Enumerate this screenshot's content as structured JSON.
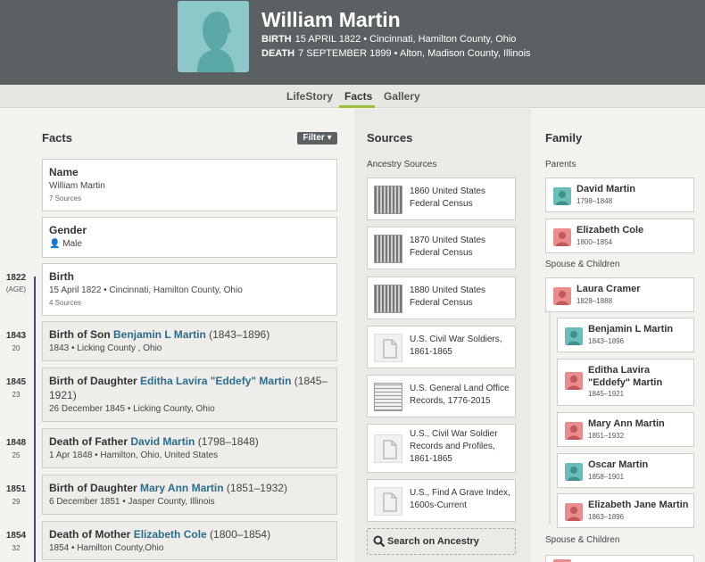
{
  "header": {
    "name": "William Martin",
    "birth_label": "BIRTH",
    "birth_value": "15 APRIL 1822 • Cincinnati, Hamilton County, Ohio",
    "death_label": "DEATH",
    "death_value": "7 SEPTEMBER 1899 • Alton, Madison County, Illinois"
  },
  "tabs": {
    "lifestory": "LifeStory",
    "facts": "Facts",
    "gallery": "Gallery",
    "active": "Facts"
  },
  "facts_col": {
    "title": "Facts",
    "filter": "Filter",
    "items": [
      {
        "title": "Name",
        "detail": "William Martin",
        "sources": "7 Sources"
      },
      {
        "title": "Gender",
        "detail": "Male"
      },
      {
        "year": "1822",
        "age": "(AGE)",
        "title": "Birth",
        "detail": "15 April 1822 • Cincinnati, Hamilton County, Ohio",
        "sources": "4 Sources"
      },
      {
        "year": "1843",
        "age": "20",
        "prefix": "Birth of Son",
        "link": "Benjamin L Martin",
        "range": "(1843–1896)",
        "detail": "1843 • Licking County , Ohio"
      },
      {
        "year": "1845",
        "age": "23",
        "prefix": "Birth of Daughter",
        "link": "Editha Lavira \"Eddefy\" Martin",
        "range": "(1845–1921)",
        "detail": "26 December 1845 • Licking County, Ohio"
      },
      {
        "year": "1848",
        "age": "25",
        "prefix": "Death of Father",
        "link": "David Martin",
        "range": "(1798–1848)",
        "detail": "1 Apr 1848 • Hamilton, Ohio, United States"
      },
      {
        "year": "1851",
        "age": "29",
        "prefix": "Birth of Daughter",
        "link": "Mary Ann Martin",
        "range": "(1851–1932)",
        "detail": "6 December 1851 • Jasper County, Illinois"
      },
      {
        "year": "1854",
        "age": "32",
        "prefix": "Death of Mother",
        "link": "Elizabeth Cole",
        "range": "(1800–1854)",
        "detail": "1854 • Hamilton County,Ohio"
      }
    ]
  },
  "sources_col": {
    "title": "Sources",
    "subtitle": "Ancestry Sources",
    "items": [
      {
        "label": "1860 United States Federal Census",
        "thumb": "census"
      },
      {
        "label": "1870 United States Federal Census",
        "thumb": "census"
      },
      {
        "label": "1880 United States Federal Census",
        "thumb": "census"
      },
      {
        "label": "U.S. Civil War Soldiers, 1861-1865",
        "thumb": "doc"
      },
      {
        "label": "U.S. General Land Office Records, 1776-2015",
        "thumb": "census"
      },
      {
        "label": "U.S., Civil War Soldier Records and Profiles, 1861-1865",
        "thumb": "doc"
      },
      {
        "label": "U.S., Find A Grave Index, 1600s-Current",
        "thumb": "doc"
      }
    ],
    "search": "Search on Ancestry"
  },
  "family_col": {
    "title": "Family",
    "parents_label": "Parents",
    "parents": [
      {
        "name": "David Martin",
        "dates": "1798–1848",
        "sex": "m"
      },
      {
        "name": "Elizabeth Cole",
        "dates": "1800–1854",
        "sex": "f"
      }
    ],
    "spouse_label": "Spouse & Children",
    "spouse": {
      "name": "Laura Cramer",
      "dates": "1828–1888",
      "sex": "f"
    },
    "children": [
      {
        "name": "Benjamin L Martin",
        "dates": "1843–1896",
        "sex": "m"
      },
      {
        "name": "Editha Lavira \"Eddefy\" Martin",
        "dates": "1845–1921",
        "sex": "f"
      },
      {
        "name": "Mary Ann Martin",
        "dates": "1851–1932",
        "sex": "f"
      },
      {
        "name": "Oscar Martin",
        "dates": "1858–1901",
        "sex": "m"
      },
      {
        "name": "Elizabeth Jane Martin",
        "dates": "1863–1896",
        "sex": "f"
      }
    ],
    "spouse2_label": "Spouse & Children"
  },
  "colors": {
    "header_bg": "#5b6063",
    "tab_underline": "#9cbf3b",
    "link": "#2c6d8f",
    "timeline": "#3f4b7a",
    "male": "#6cbdb8",
    "female": "#e98c8e"
  }
}
